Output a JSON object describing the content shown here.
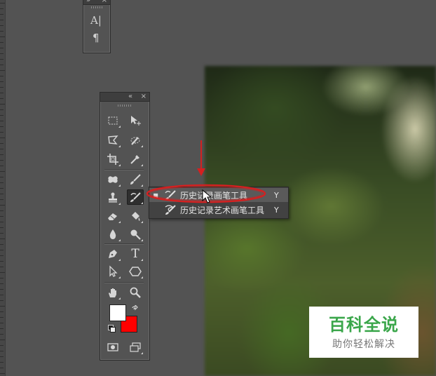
{
  "character_panel": {
    "collapse_glyph": "»",
    "close_glyph": "×",
    "items": [
      {
        "name": "character-panel-icon",
        "glyph": "A|"
      },
      {
        "name": "paragraph-panel-icon",
        "glyph": "¶"
      }
    ]
  },
  "tools_panel": {
    "collapse_glyph": "«",
    "close_glyph": "×",
    "text_tool_glyph": "T"
  },
  "flyout_menu": {
    "items": [
      {
        "label": "历史记录画笔工具",
        "shortcut": "Y",
        "selected": true,
        "icon": "history-brush-icon"
      },
      {
        "label": "历史记录艺术画笔工具",
        "shortcut": "Y",
        "selected": false,
        "icon": "art-history-brush-icon"
      }
    ],
    "selected_marker": "■"
  },
  "colors": {
    "foreground": "#ffffff",
    "background": "#ff0000",
    "annotation": "#d42020"
  },
  "watermark": {
    "title": "百科全说",
    "subtitle": "助你轻松解决"
  }
}
